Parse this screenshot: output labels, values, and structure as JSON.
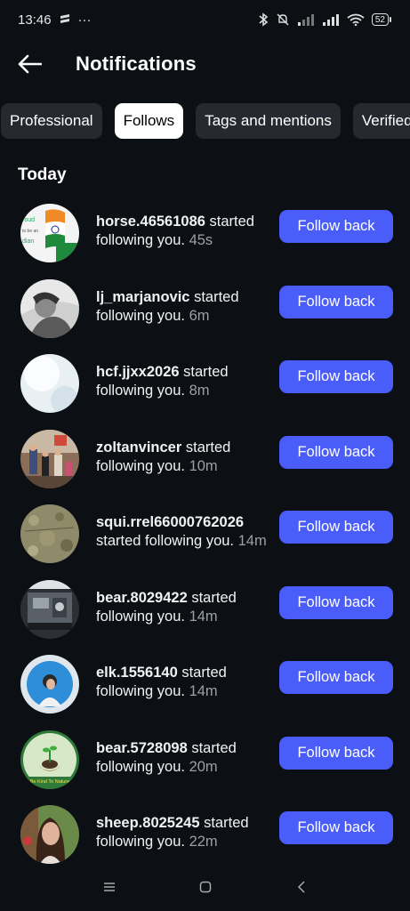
{
  "status_bar": {
    "time": "13:46",
    "more": "···",
    "battery": "52"
  },
  "header": {
    "title": "Notifications"
  },
  "tabs": [
    {
      "label": "Professional",
      "active": false
    },
    {
      "label": "Follows",
      "active": true
    },
    {
      "label": "Tags and mentions",
      "active": false
    },
    {
      "label": "Verified",
      "active": false
    }
  ],
  "section_title": "Today",
  "notifications": [
    {
      "username": "horse.46561086",
      "action": " started following you.",
      "time": "45s",
      "button": "Follow back",
      "avatar": "flag-badge-avatar"
    },
    {
      "username": "lj_marjanovic",
      "action": " started following you.",
      "time": "6m",
      "button": "Follow back",
      "avatar": "bw-portrait-avatar"
    },
    {
      "username": "hcf.jjxx2026",
      "action": " started following you.",
      "time": "8m",
      "button": "Follow back",
      "avatar": "light-blank-avatar"
    },
    {
      "username": "zoltanvincer",
      "action": " started following you.",
      "time": "10m",
      "button": "Follow back",
      "avatar": "family-photo-avatar"
    },
    {
      "username": "squi.rrel66000762026",
      "action": " started following you.",
      "time": "14m",
      "button": "Follow back",
      "avatar": "ground-texture-avatar"
    },
    {
      "username": "bear.8029422",
      "action": " started following you.",
      "time": "14m",
      "button": "Follow back",
      "avatar": "machine-photo-avatar"
    },
    {
      "username": "elk.1556140",
      "action": " started following you.",
      "time": "14m",
      "button": "Follow back",
      "avatar": "blue-portrait-avatar"
    },
    {
      "username": "bear.5728098",
      "action": " started following you.",
      "time": "20m",
      "button": "Follow back",
      "avatar": "be-kind-to-nature-avatar",
      "avatar_text": "Be Kind To Nature"
    },
    {
      "username": "sheep.8025245",
      "action": " started following you.",
      "time": "22m",
      "button": "Follow back",
      "avatar": "woman-portrait-avatar"
    }
  ],
  "avatar_text": {
    "flag_top": "roud",
    "flag_mid": "to be an",
    "flag_bottom": "dian"
  },
  "colors": {
    "background": "#0c0f14",
    "button": "#4a5df9",
    "tab_bg": "#262a30",
    "muted": "#9aa0a6"
  }
}
